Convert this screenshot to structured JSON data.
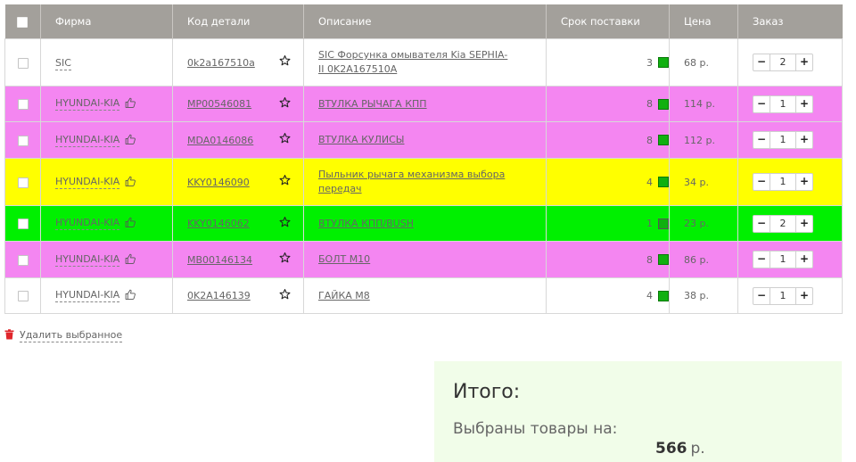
{
  "table": {
    "headers": {
      "brand": "Фирма",
      "code": "Код детали",
      "description": "Описание",
      "term": "Срок поставки",
      "price": "Цена",
      "order": "Заказ"
    },
    "rows": [
      {
        "brand": "SIC",
        "code": "0k2a167510a",
        "description": "SIC Форсунка омывателя Kia SEPHIA-II 0K2A167510A",
        "term": "3",
        "price": "68 р.",
        "qty": "2"
      },
      {
        "brand": "HYUNDAI-KIA",
        "code": "MP00546081",
        "description": "ВТУЛКА РЫЧАГА КПП",
        "term": "8",
        "price": "114 р.",
        "qty": "1"
      },
      {
        "brand": "HYUNDAI-KIA",
        "code": "MDA0146086",
        "description": "ВТУЛКА КУЛИСЫ",
        "term": "8",
        "price": "112 р.",
        "qty": "1"
      },
      {
        "brand": "HYUNDAI-KIA",
        "code": "KKY0146090",
        "description": "Пыльник рычага механизма выбора передач",
        "term": "4",
        "price": "34 р.",
        "qty": "1"
      },
      {
        "brand": "HYUNDAI-KIA",
        "code": "KKY0146062",
        "description": "ВТУЛКА КПП/BUSH",
        "term": "1",
        "price": "23 р.",
        "qty": "2"
      },
      {
        "brand": "HYUNDAI-KIA",
        "code": "MB00146134",
        "description": "БОЛТ М10",
        "term": "8",
        "price": "86 р.",
        "qty": "1"
      },
      {
        "brand": "HYUNDAI-KIA",
        "code": "0K2A146139",
        "description": "ГАЙКА М8",
        "term": "4",
        "price": "38 р.",
        "qty": "1"
      }
    ]
  },
  "colors": {
    "pink": "#f486f1",
    "yellow": "#ffff00",
    "green": "#00f000",
    "status_green": "#10b010",
    "header_gray": "#a3a09b",
    "delete_red": "#e0262b",
    "total_bg": "#f1fde9"
  },
  "stepper": {
    "minus": "−",
    "plus": "+"
  },
  "actions": {
    "delete_selected": "Удалить выбранное"
  },
  "total": {
    "title": "Итого:",
    "subtitle": "Выбраны товары на:",
    "amount": "566",
    "currency": "р."
  }
}
